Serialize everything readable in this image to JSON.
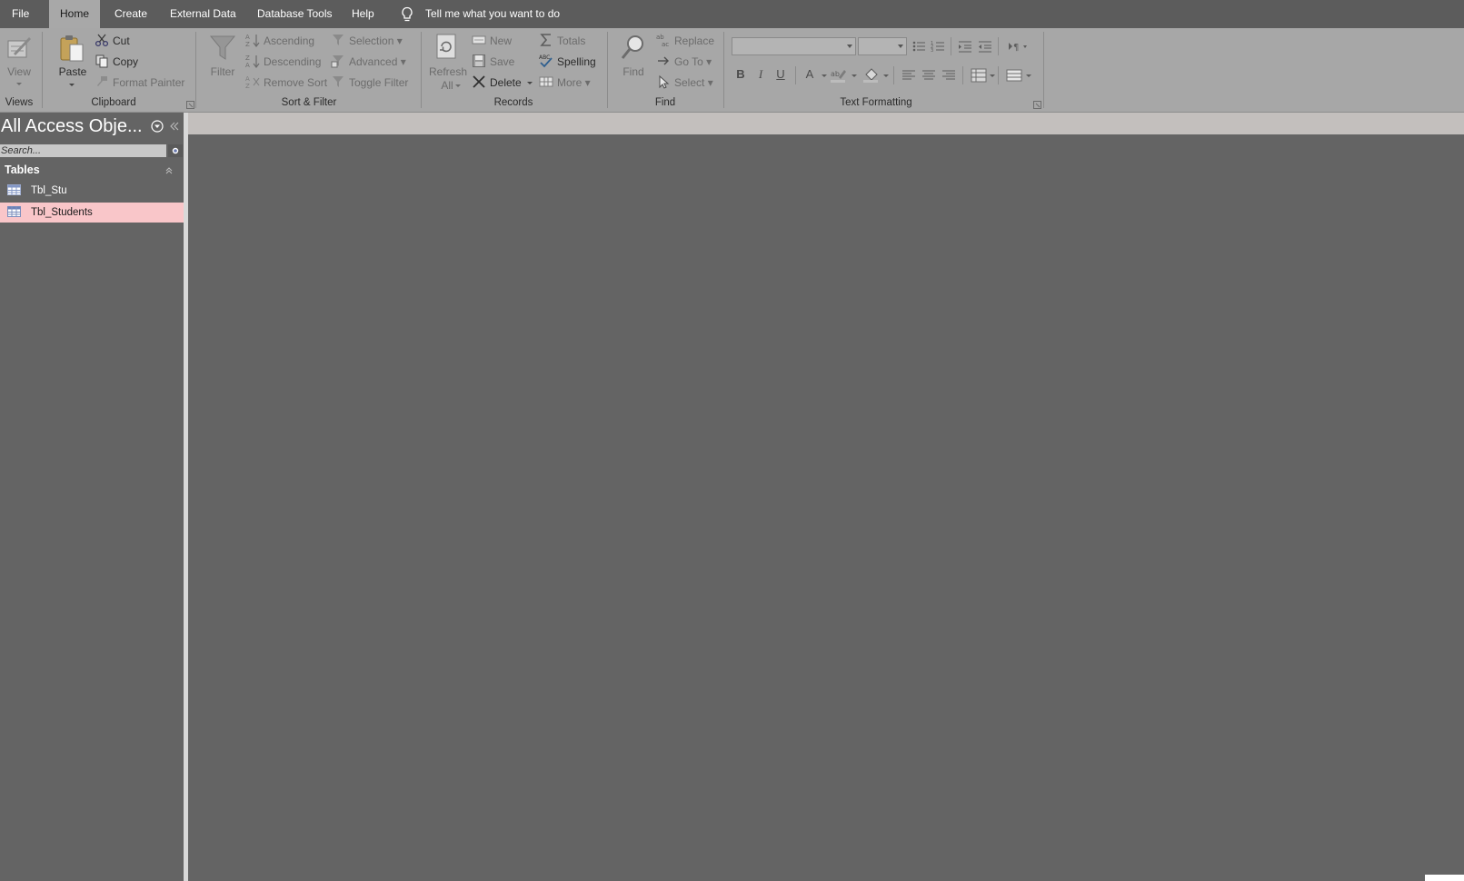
{
  "menu": {
    "tabs": [
      "File",
      "Home",
      "Create",
      "External Data",
      "Database Tools",
      "Help"
    ],
    "active": "Home",
    "tell_me": "Tell me what you want to do"
  },
  "ribbon": {
    "views": {
      "view_label": "View",
      "group_label": "Views"
    },
    "clipboard": {
      "paste_label": "Paste",
      "cut_label": "Cut",
      "copy_label": "Copy",
      "format_painter_label": "Format Painter",
      "group_label": "Clipboard"
    },
    "sort_filter": {
      "filter_label": "Filter",
      "ascending_label": "Ascending",
      "descending_label": "Descending",
      "remove_sort_label": "Remove Sort",
      "selection_label": "Selection",
      "advanced_label": "Advanced",
      "toggle_filter_label": "Toggle Filter",
      "group_label": "Sort & Filter"
    },
    "records": {
      "refresh_label": "Refresh",
      "refresh_label2": "All",
      "new_label": "New",
      "save_label": "Save",
      "delete_label": "Delete",
      "totals_label": "Totals",
      "spelling_label": "Spelling",
      "more_label": "More",
      "group_label": "Records"
    },
    "find": {
      "find_label": "Find",
      "replace_label": "Replace",
      "goto_label": "Go To",
      "select_label": "Select",
      "group_label": "Find"
    },
    "text_formatting": {
      "bold": "B",
      "italic": "I",
      "underline": "U",
      "font_color": "A",
      "group_label": "Text Formatting"
    }
  },
  "nav_pane": {
    "title": "All Access Obje...",
    "search_placeholder": "Search...",
    "section_label": "Tables",
    "items": [
      {
        "label": "Tbl_Stu",
        "selected": false
      },
      {
        "label": "Tbl_Students",
        "selected": true
      }
    ]
  },
  "colors": {
    "menubar": "#5c5c5c",
    "ribbon": "#a7a7a7",
    "workspace": "#646464",
    "selected_item": "#f9c6c9"
  }
}
